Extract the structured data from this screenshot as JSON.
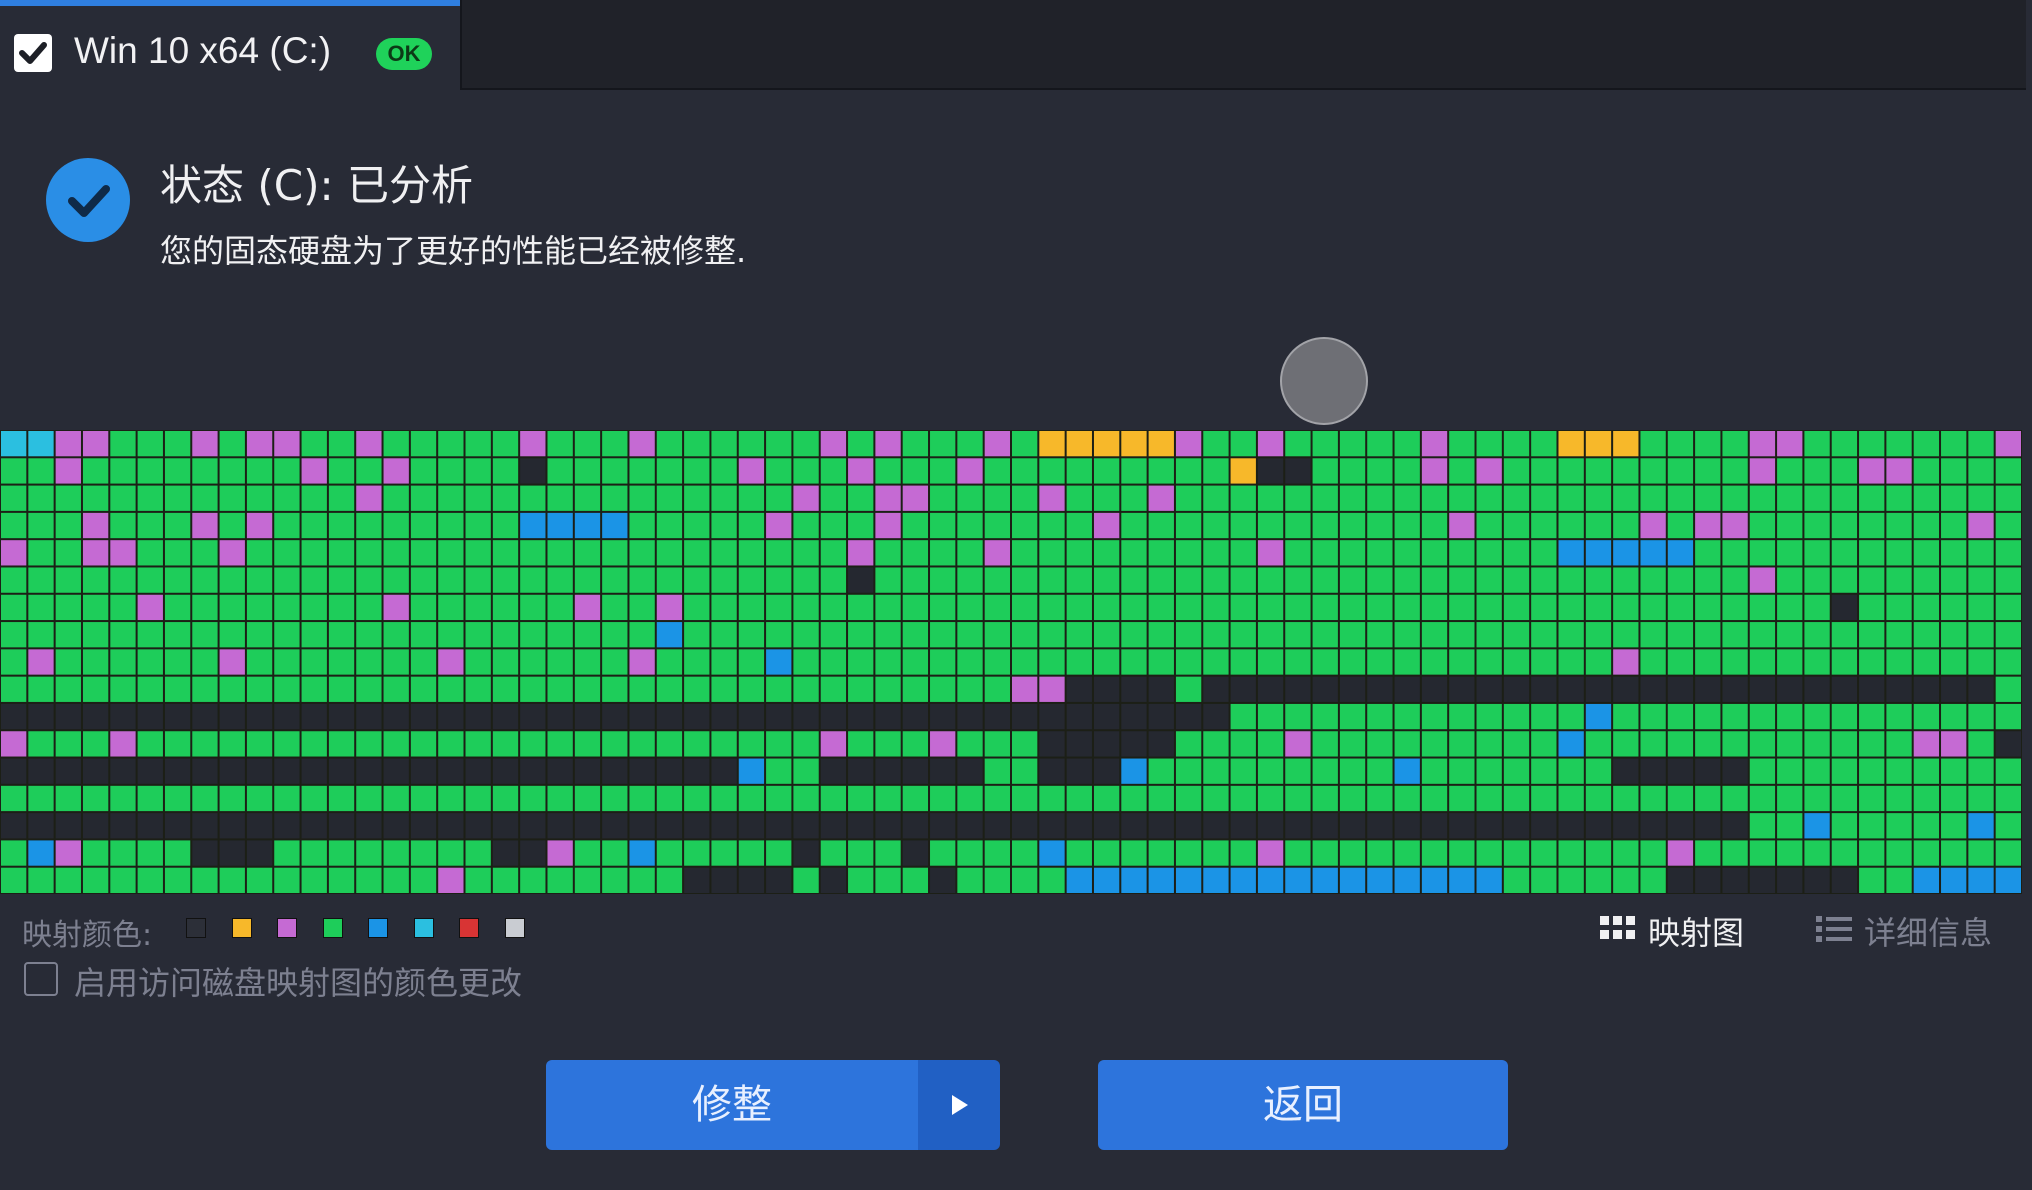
{
  "tab": {
    "label": "Win 10 x64 (C:)",
    "badge": "OK",
    "checked": true
  },
  "status": {
    "title": "状态 (C): 已分析",
    "description": "您的固态硬盘为了更好的性能已经被修整."
  },
  "colors": {
    "free": "#252830",
    "used": "#1ecd5a",
    "purple": "#c56ad3",
    "yellow": "#f7b82a",
    "blue": "#1b94e6",
    "cyan": "#2bbfe0",
    "red": "#d83434",
    "lightgray": "#c9ccd2",
    "accent": "#2d74dc",
    "ok_green": "#1fd25a"
  },
  "disk_map": {
    "columns": 74,
    "rows": 17,
    "legend_code": "0=free(dark), G=used(green), P=purple, Y=yellow, B=blue, C=cyan",
    "grid": [
      "CCPPGGGPGPPGGPGGGGGPGGGPGGGGGGPGPGGGPGYYYYYPGGPGGGGGPGGGGYYYGGGGPPGGGGGGGP",
      "GGPGGGGGGGGPGGPGGGG0GGGGGGGPGGGPGGGPGGGGGGGGGY00GGGGPGPGGGGGGGGGPGGGPPGGGG",
      "GGGGGGGGGGGGGPGGGGGGGGGGGGGGGPGGPPGGGGPGGGPGGGGGGGGGGGGGGGGGGGGGGGGGGGGGGG",
      "GGGPGGGPGPGGGGGGGGGBBBBGGGGGPGGGPGGGGGGGPGGGGGGGGGGGGPGGGGGGPGPPGGGGGGGGPG",
      "PGGPPGGGPGGGGGGGGGGGGGGGGGGGGGGPGGGGPGGGGGGGGGPGGGGGGGGGGBBBBBGGGGGGGGGGGG",
      "GGGGGGGGGGGGGGGGGGGGGGGGGGGGGGG0GGGGGGGGGGGGGGGGGGGGGGGGGGGGGGGGPGGGGGGGGG",
      "GGGGGPGGGGGGGGPGGGGGGPGGPGGGGGGGGGGGGGGGGGGGGGGGGGGGGGGGGGGGGGGGGGG0GGGGGG",
      "GGGGGGGGGGGGGGGGGGGGGGGGBGGGGGGGGGGGGGGGGGGGGGGGGGGGGGGGGGGGGGGGGGGGGGGGGG",
      "GPGGGGGGPGGGGGGGPGGGGGGPGGGGBGGGGGGGGGGGGGGGGGGGGGGGGGGGGGGPGGGGGGGGGGGGGG",
      "GGGGGGGGGGGGGGGGGGGGGGGGGGGGGGGGGGGGGPP0000G00000000000000000000000000000",
      "000000000000000000000000000000000000000000000GGGGGGGGGGGGGBGGGGGGGGGGGGG",
      "PGGGPGGGGGGGGGGGGGGGGGGGGGGGGGPGGGPGGG00000GGGGPGGGGGGGGGBGGGGGGGGGGGGPPG0",
      "000000000000000000000000000BGG000000GG000BGGGGGGGGGBGGGGGGG00000GGGGGGGGGG",
      "GGGGGGGGGGGGGGGGGGGGGGGGGGGGGGGGGGGGGGGGGGGGGGGGGGGGGGGGGGGGGGGGGGGGGGGGGG",
      "0000000000000000000000000000000000000000000000000000000000000000GGBGGGGGBG",
      "GBPGGGG000GGGGGGGG00PGGBGGGGG0GGG0GGGGBGGGGGGGPGGGGGGGGGGGGGGPGGGGGGGGGGGG",
      "GGGGGGGGGGGGGGGGPGGGGGGGG0000G0GGG0GGGGBBBBBBBBBBBBBBBBGGGGGG0000000GGBBBB"
    ]
  },
  "legend": {
    "label": "映射颜色:",
    "swatches": [
      "#2c2f38",
      "#f7b82a",
      "#c56ad3",
      "#1ecd5a",
      "#1b94e6",
      "#2bbfe0",
      "#d83434",
      "#c9ccd2"
    ]
  },
  "views": {
    "map_label": "映射图",
    "details_label": "详细信息"
  },
  "option": {
    "enable_label": "启用访问磁盘映射图的颜色更改",
    "checked": false
  },
  "buttons": {
    "trim_label": "修整",
    "back_label": "返回"
  }
}
